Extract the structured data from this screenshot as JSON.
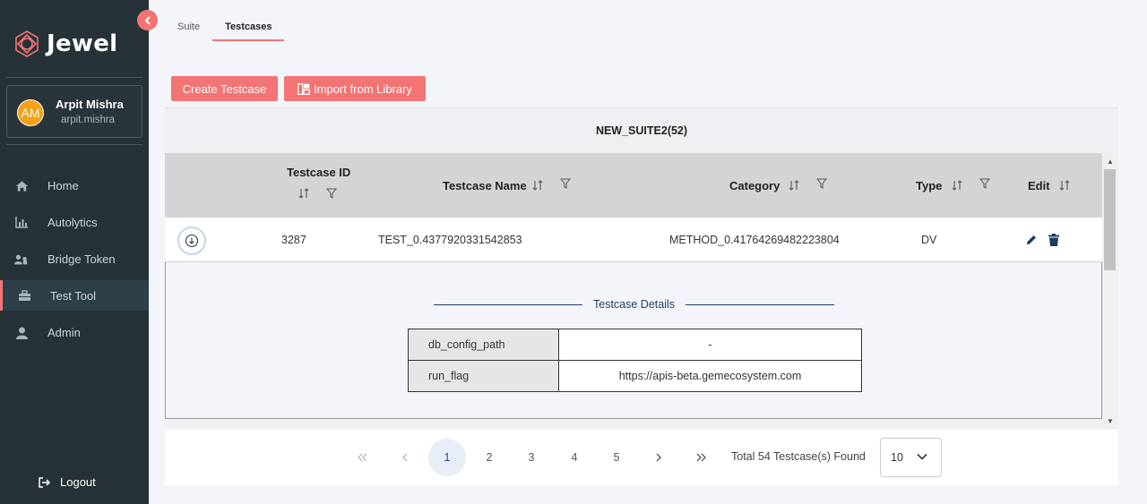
{
  "brand": {
    "name": "Jewel"
  },
  "user": {
    "initials": "AM",
    "name": "Arpit Mishra",
    "handle": "arpit.mishra"
  },
  "nav": {
    "items": [
      {
        "label": "Home",
        "icon": "home-icon"
      },
      {
        "label": "Autolytics",
        "icon": "bar-chart-icon"
      },
      {
        "label": "Bridge Token",
        "icon": "users-key-icon"
      },
      {
        "label": "Test Tool",
        "icon": "toolbox-icon",
        "active": true
      },
      {
        "label": "Admin",
        "icon": "user-icon"
      }
    ],
    "logout": "Logout"
  },
  "tabs": [
    {
      "label": "Suite",
      "active": false
    },
    {
      "label": "Testcases",
      "active": true
    }
  ],
  "actions": {
    "create": "Create Testcase",
    "import": "Import from Library"
  },
  "suite": {
    "title": "NEW_SUITE2(52)"
  },
  "table": {
    "columns": [
      "Testcase ID",
      "Testcase Name",
      "Category",
      "Type",
      "Edit"
    ],
    "rows": [
      {
        "id": "3287",
        "name": "TEST_0.4377920331542853",
        "category": "METHOD_0.41764269482223804",
        "type": "DV"
      }
    ]
  },
  "details": {
    "title": "Testcase Details",
    "rows": [
      {
        "key": "db_config_path",
        "value": "-"
      },
      {
        "key": "run_flag",
        "value": "https://apis-beta.gemecosystem.com"
      }
    ]
  },
  "pagination": {
    "pages": [
      "1",
      "2",
      "3",
      "4",
      "5"
    ],
    "current": "1",
    "total_text": "Total 54 Testcase(s) Found",
    "per_page": "10"
  },
  "colors": {
    "accent": "#f27474",
    "sidebar": "#263238",
    "avatar": "#f5a21a"
  }
}
